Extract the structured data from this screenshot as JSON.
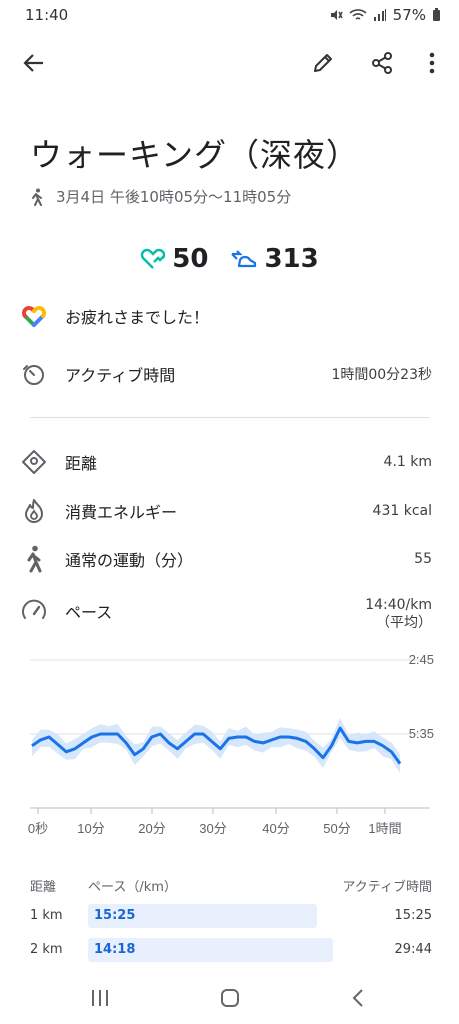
{
  "status": {
    "time": "11:40",
    "battery": "57%"
  },
  "header": {
    "back_icon": "arrow-left-icon",
    "edit_icon": "pencil-icon",
    "share_icon": "share-icon",
    "more_icon": "more-vert-icon"
  },
  "activity": {
    "title": "ウォーキング（深夜）",
    "datetime": "3月4日 午後10時05分～11時05分"
  },
  "scores": {
    "heart_points": "50",
    "steps": "313",
    "heart_color": "#00bfa5",
    "steps_color": "#1a73e8"
  },
  "message": "お疲れさまでした！",
  "active_time": {
    "label": "アクティブ時間",
    "value": "1時間00分23秒"
  },
  "metrics": [
    {
      "icon": "location-icon",
      "label": "距離",
      "value": "4.1 km"
    },
    {
      "icon": "fire-icon",
      "label": "消費エネルギー",
      "value": "431 kcal"
    },
    {
      "icon": "walking-icon",
      "label": "通常の運動（分）",
      "value": "55"
    },
    {
      "icon": "speedometer-icon",
      "label": "ペース",
      "value": "14:40/km",
      "value2": "（平均）"
    }
  ],
  "chart_data": {
    "type": "line",
    "y_ticks": [
      "2:45",
      "5:35"
    ],
    "x_ticks": [
      "0秒",
      "10分",
      "20分",
      "30分",
      "40分",
      "50分",
      "1時間"
    ],
    "series": [
      {
        "values": [
          0.58,
          0.54,
          0.52,
          0.57,
          0.62,
          0.6,
          0.56,
          0.52,
          0.5,
          0.5,
          0.5,
          0.56,
          0.64,
          0.6,
          0.52,
          0.5,
          0.56,
          0.6,
          0.55,
          0.5,
          0.5,
          0.55,
          0.6,
          0.53,
          0.52,
          0.52,
          0.55,
          0.56,
          0.54,
          0.52,
          0.52,
          0.53,
          0.55,
          0.6,
          0.66,
          0.58,
          0.46,
          0.55,
          0.56,
          0.55,
          0.55,
          0.58,
          0.62,
          0.7
        ]
      }
    ],
    "line_color": "#1a73e8",
    "band_color": "#d6e6fb"
  },
  "table": {
    "headers": {
      "distance": "距離",
      "pace": "ペース（/km）",
      "active": "アクティブ時間"
    },
    "rows": [
      {
        "distance": "1 km",
        "pace": "15:25",
        "active": "15:25",
        "fill": 0.74
      },
      {
        "distance": "2 km",
        "pace": "14:18",
        "active": "29:44",
        "fill": 0.79
      }
    ]
  }
}
